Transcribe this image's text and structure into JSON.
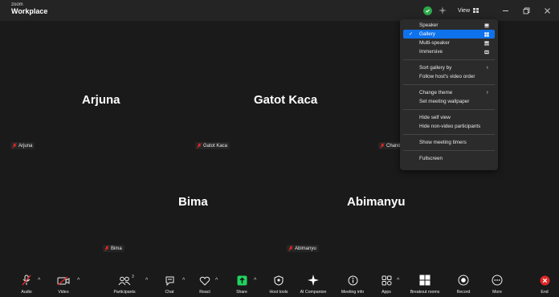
{
  "titlebar": {
    "brand_small": "zoom",
    "brand": "Workplace",
    "view_label": "View"
  },
  "tiles": [
    {
      "name": "Arjuna",
      "label": "Arjuna"
    },
    {
      "name": "Gatot Kaca",
      "label": "Gatot Kaca"
    },
    {
      "name": "Bima",
      "label": "Bima"
    },
    {
      "name": "Abimanyu",
      "label": "Abimanyu"
    }
  ],
  "partial_label": "Chand",
  "menu": {
    "layout": {
      "speaker": "Speaker",
      "gallery": "Gallery",
      "multi_speaker": "Multi-speaker",
      "immersive": "Immersive",
      "selected": "Gallery"
    },
    "sort_gallery": "Sort gallery by",
    "follow_host": "Follow host's video order",
    "change_theme": "Change theme",
    "set_wallpaper": "Set meeting wallpaper",
    "hide_self": "Hide self view",
    "hide_nonvideo": "Hide non-video participants",
    "show_timers": "Show meeting timers",
    "fullscreen": "Fullscreen"
  },
  "toolbar": {
    "audio": "Audio",
    "video": "Video",
    "participants": "Participants",
    "participants_count": "3",
    "chat": "Chat",
    "react": "React",
    "share": "Share",
    "host_tools": "Host tools",
    "ai_companion": "AI Companion",
    "meeting_info": "Meeting info",
    "apps": "Apps",
    "breakout_rooms": "Breakout rooms",
    "record": "Record",
    "more": "More",
    "end": "End"
  },
  "colors": {
    "accent": "#0e72ed",
    "danger": "#e02828",
    "share_green": "#23d160",
    "shield_green": "#2ea84a"
  }
}
